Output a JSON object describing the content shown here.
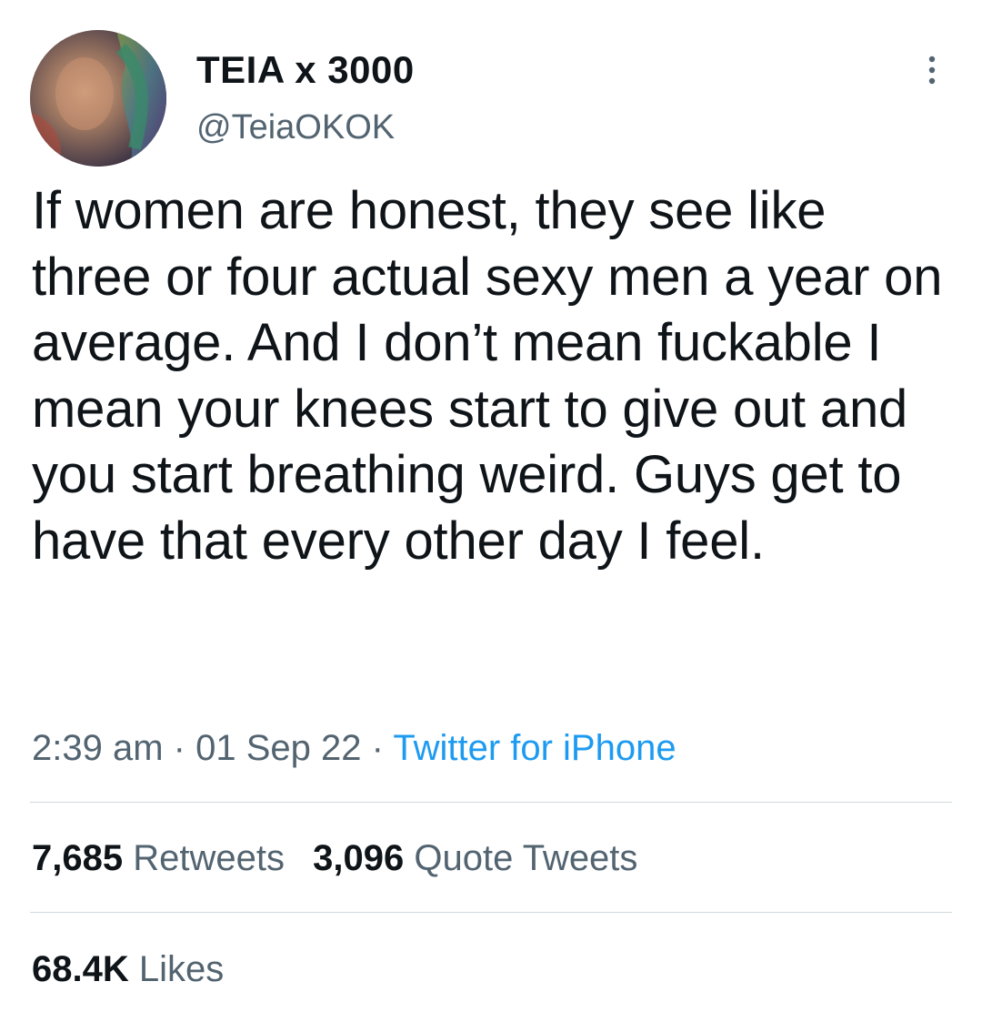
{
  "author": {
    "display_name": "TEIA x 3000",
    "handle": "@TeiaOKOK",
    "avatar_icon": "profile-photo"
  },
  "more_icon": "more-vertical-icon",
  "tweet": {
    "text": "If women are honest, they see like three or four actual sexy men a year on average. And I don’t mean fuckable I mean your knees start to give out and you start breathing weird. Guys get to have that every other day I feel.",
    "time": "2:39 am",
    "separator": "·",
    "date": "01 Sep 22",
    "source": "Twitter for iPhone"
  },
  "stats": {
    "retweets_count": "7,685",
    "retweets_label": "Retweets",
    "quotes_count": "3,096",
    "quotes_label": "Quote Tweets",
    "likes_count": "68.4K",
    "likes_label": "Likes"
  },
  "colors": {
    "text_primary": "#0f1419",
    "text_secondary": "#536471",
    "link": "#1d9bf0",
    "divider": "#cfd9de"
  }
}
